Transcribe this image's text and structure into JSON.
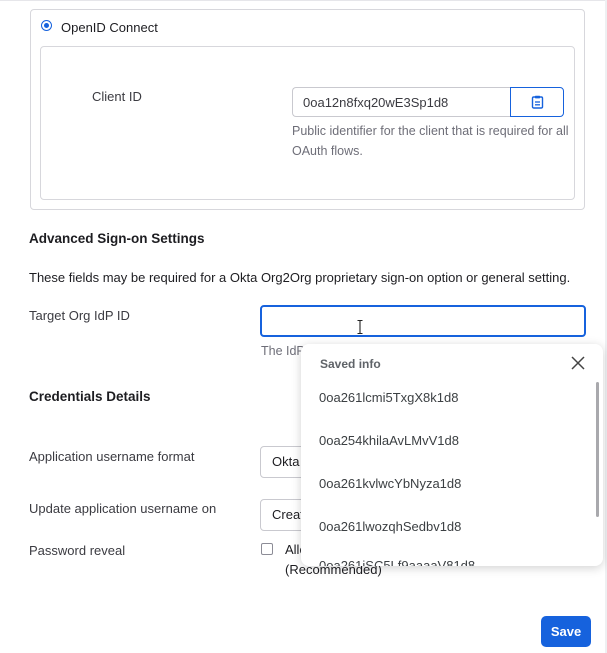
{
  "oidc": {
    "option_label": "OpenID Connect",
    "client_id_label": "Client ID",
    "client_id_value": "0oa12n8fxq20wE3Sp1d8",
    "client_id_help": "Public identifier for the client that is required for all OAuth flows."
  },
  "advanced": {
    "title": "Advanced Sign-on Settings",
    "description": "These fields may be required for a Okta Org2Org proprietary sign-on option or general setting.",
    "target_label": "Target Org IdP ID",
    "target_value": "",
    "target_help_partial": "The IdP"
  },
  "credentials": {
    "title": "Credentials Details",
    "username_format_label": "Application username format",
    "username_format_value_partial": "Okta",
    "update_on_label": "Update application username on",
    "update_on_value_partial": "Creat",
    "password_reveal_label": "Password reveal",
    "password_reveal_option_partial": "Allo",
    "password_reveal_recommended": "(Recommended)"
  },
  "autofill_popup": {
    "title": "Saved info",
    "items": [
      "0oa261lcmi5TxgX8k1d8",
      "0oa254khilaAvLMvV1d8",
      "0oa261kvlwcYbNyza1d8",
      "0oa261lwozqhSedbv1d8"
    ],
    "partial_item": "0oa261iSC5Lf9aaaaV81d8"
  },
  "footer": {
    "save_label": "Save"
  }
}
